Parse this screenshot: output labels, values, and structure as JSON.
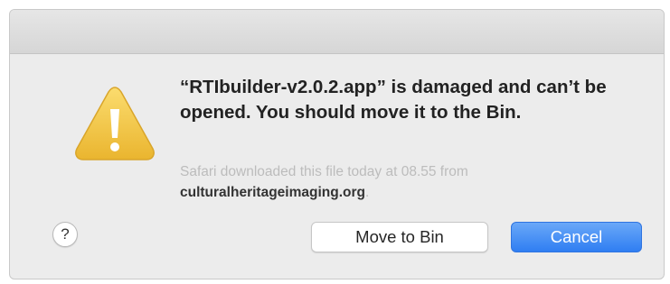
{
  "dialog": {
    "message": "“RTIbuilder-v2.0.2.app” is damaged and can’t be opened. You should move it to the Bin.",
    "info_prefix": "Safari downloaded this file today at 08.55 from",
    "info_domain": "culturalheritageimaging.org",
    "info_suffix": ".",
    "icon": "warning-icon"
  },
  "buttons": {
    "help_label": "?",
    "move_to_bin_label": "Move to Bin",
    "cancel_label": "Cancel"
  },
  "colors": {
    "dialog_background": "#ececec",
    "warning_yellow": "#f5c94a",
    "cancel_blue": "#3b86f4",
    "info_text": "#bcbcbc"
  }
}
